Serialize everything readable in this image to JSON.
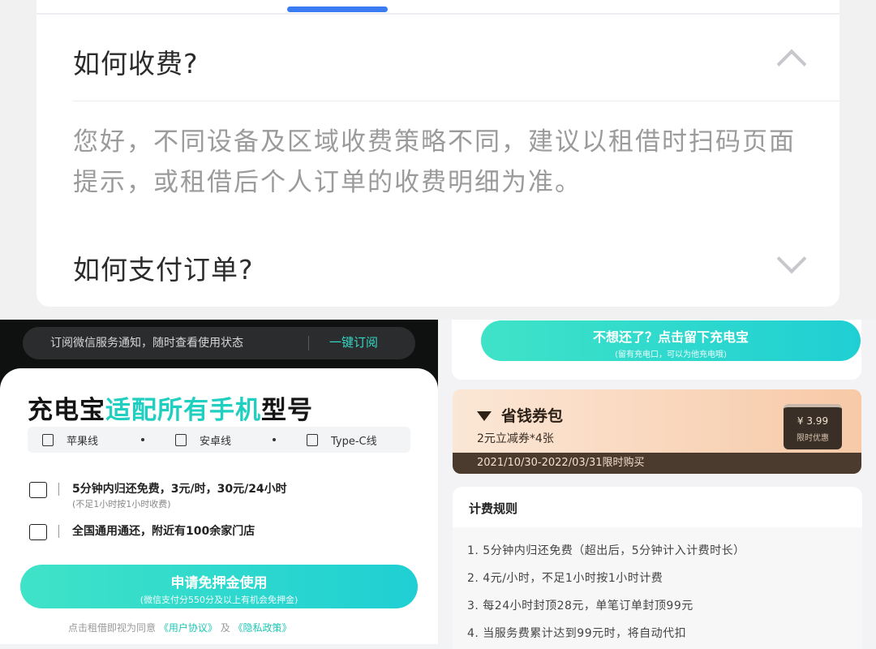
{
  "faq": {
    "q1": "如何收费?",
    "a1": "您好，不同设备及区域收费策略不同，建议以租借时扫码页面提示，或租借后个人订单的收费明细为准。",
    "q2": "如何支付订单?",
    "accent": "#3b7cf5"
  },
  "rental": {
    "notice_text": "订阅微信服务通知，随时查看使用状态",
    "notice_button": "一键订阅",
    "headline_prefix": "充电宝",
    "headline_highlight": "适配所有手机",
    "headline_suffix": "型号",
    "cables": [
      "苹果线",
      "安卓线",
      "Type-C线"
    ],
    "features": [
      {
        "text": "5分钟内归还免费，3元/时，30元/24小时",
        "sub": "(不足1小时按1小时收费)"
      },
      {
        "text": "全国通用通还，附近有100余家门店",
        "sub": ""
      }
    ],
    "apply_label": "申请免押金使用",
    "apply_sub": "(微信支付分550分及以上有机会免押金)",
    "agree_prefix": "点击租借即视为同意",
    "agree_link1": "《用户协议》",
    "agree_and": "及",
    "agree_link2": "《隐私政策》",
    "accent": "#20cfc0"
  },
  "right": {
    "keep_label": "不想还了？点击留下充电宝",
    "keep_sub": "(留有充电口，可以为他充电哦)",
    "coupon_title": "省钱券包",
    "coupon_desc": "2元立减券*4张",
    "coupon_price": "¥ 3.99",
    "coupon_price_note": "限时优惠",
    "coupon_date": "2021/10/30-2022/03/31限时购买",
    "rules_title": "计费规则",
    "rules": [
      "1. 5分钟内归还免费（超出后，5分钟计入计费时长）",
      "2. 4元/小时，不足1小时按1小时计费",
      "3. 每24小时封顶28元，单笔订单封顶99元",
      "4. 当服务费累计达到99元时，将自动代扣"
    ]
  }
}
